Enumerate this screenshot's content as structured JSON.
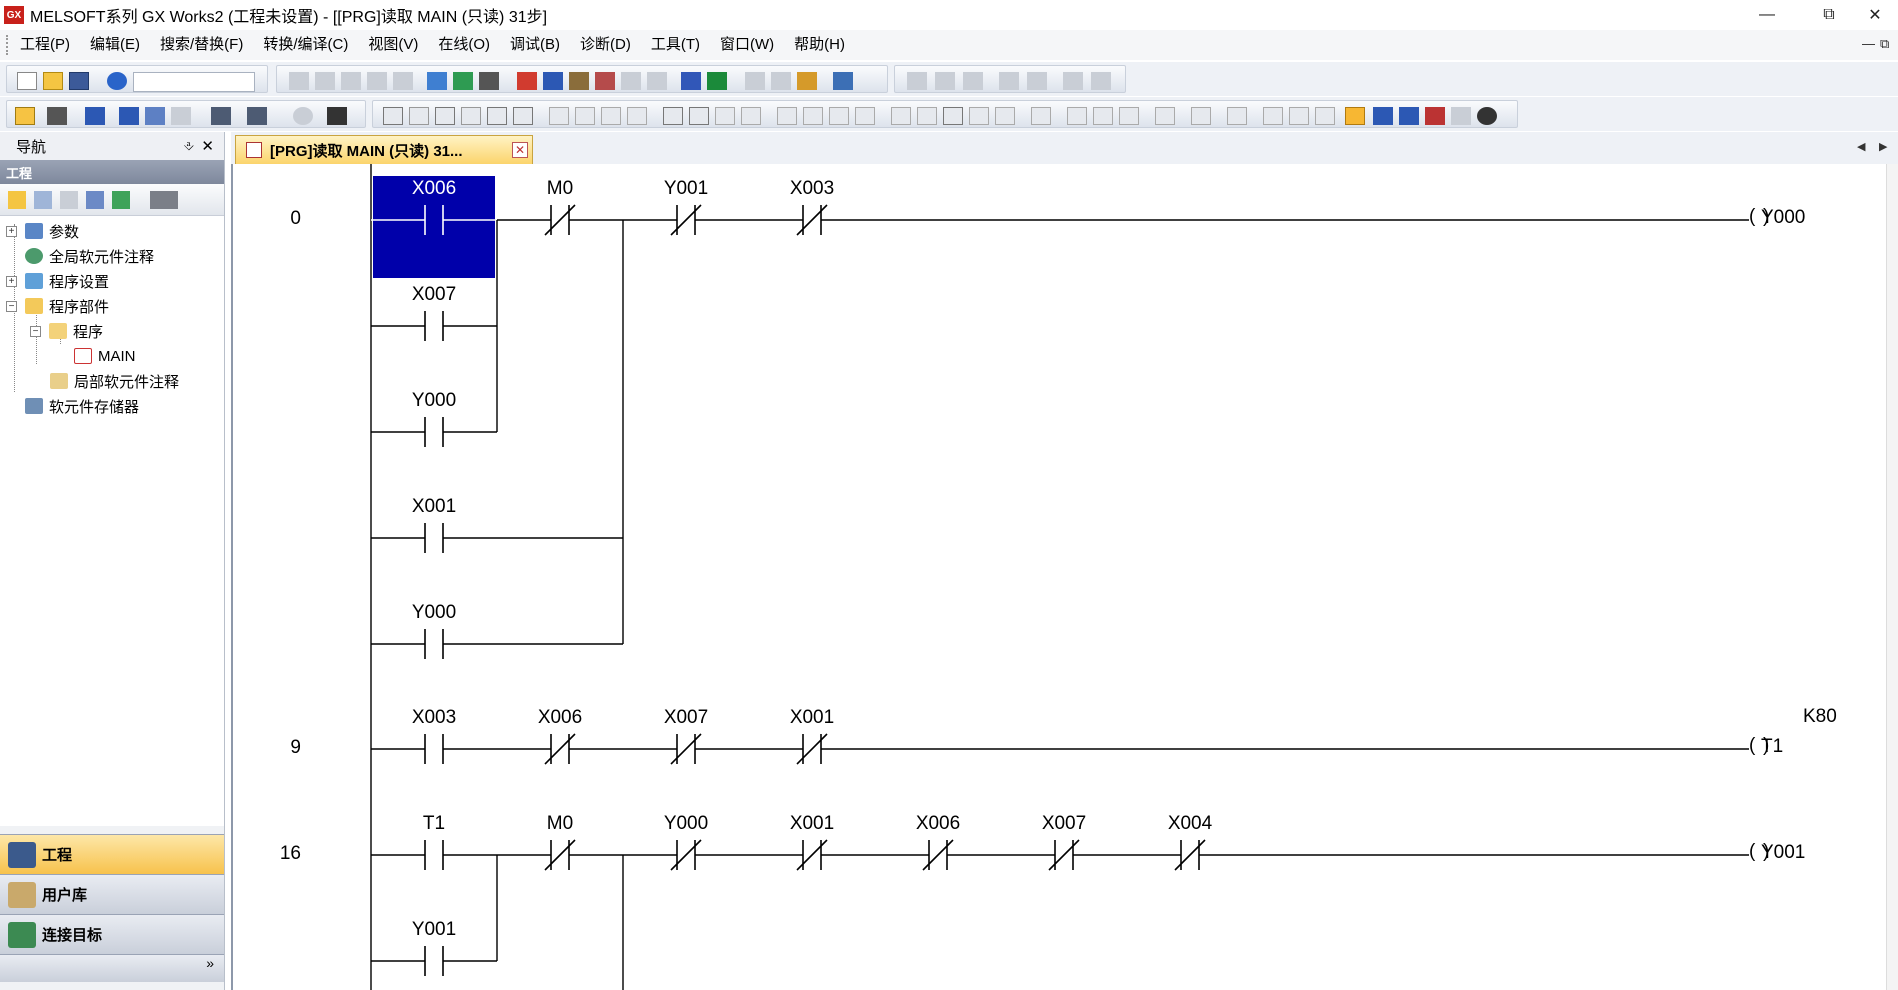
{
  "window": {
    "title": "MELSOFT系列 GX Works2 (工程未设置) - [[PRG]读取 MAIN (只读) 31步]",
    "logo_text": "GX"
  },
  "menu": [
    "工程(P)",
    "编辑(E)",
    "搜索/替换(F)",
    "转换/编译(C)",
    "视图(V)",
    "在线(O)",
    "调试(B)",
    "诊断(D)",
    "工具(T)",
    "窗口(W)",
    "帮助(H)"
  ],
  "nav": {
    "title": "导航",
    "section": "工程",
    "tree": [
      {
        "label": "参数",
        "level": 0,
        "expander": "+"
      },
      {
        "label": "全局软元件注释",
        "level": 0,
        "expander": ""
      },
      {
        "label": "程序设置",
        "level": 0,
        "expander": "+"
      },
      {
        "label": "程序部件",
        "level": 0,
        "expander": "-"
      },
      {
        "label": "程序",
        "level": 1,
        "expander": "-"
      },
      {
        "label": "MAIN",
        "level": 2,
        "expander": ""
      },
      {
        "label": "局部软元件注释",
        "level": 1,
        "expander": ""
      },
      {
        "label": "软元件存储器",
        "level": 0,
        "expander": ""
      }
    ],
    "bottom": [
      {
        "label": "工程",
        "active": true
      },
      {
        "label": "用户库",
        "active": false
      },
      {
        "label": "连接目标",
        "active": false
      }
    ],
    "more": "»"
  },
  "editor": {
    "tab_label": "[PRG]读取 MAIN (只读) 31...",
    "selected_contact": "X006",
    "rungs": [
      {
        "step": "0",
        "series": [
          {
            "dev": "X006",
            "type": "NO"
          },
          {
            "dev": "M0",
            "type": "NC"
          },
          {
            "dev": "Y001",
            "type": "NC"
          },
          {
            "dev": "X003",
            "type": "NC"
          }
        ],
        "parallel_first": [
          "X007",
          "Y000"
        ],
        "parallel_to_second": [
          "X001",
          "Y000"
        ],
        "coil": "Y000",
        "coil_const": ""
      },
      {
        "step": "9",
        "series": [
          {
            "dev": "X003",
            "type": "NO"
          },
          {
            "dev": "X006",
            "type": "NC"
          },
          {
            "dev": "X007",
            "type": "NC"
          },
          {
            "dev": "X001",
            "type": "NC"
          }
        ],
        "coil": "T1",
        "coil_const": "K80"
      },
      {
        "step": "16",
        "series": [
          {
            "dev": "T1",
            "type": "NO"
          },
          {
            "dev": "M0",
            "type": "NC"
          },
          {
            "dev": "Y000",
            "type": "NC"
          },
          {
            "dev": "X001",
            "type": "NC"
          },
          {
            "dev": "X006",
            "type": "NC"
          },
          {
            "dev": "X007",
            "type": "NC"
          },
          {
            "dev": "X004",
            "type": "NC"
          }
        ],
        "parallel_first": [
          "Y001"
        ],
        "coil": "Y001",
        "coil_const": ""
      }
    ]
  },
  "colors": {
    "selection": "#0000aa",
    "active_nav": "#f7c24c",
    "tab_active": "#fbd46c"
  }
}
